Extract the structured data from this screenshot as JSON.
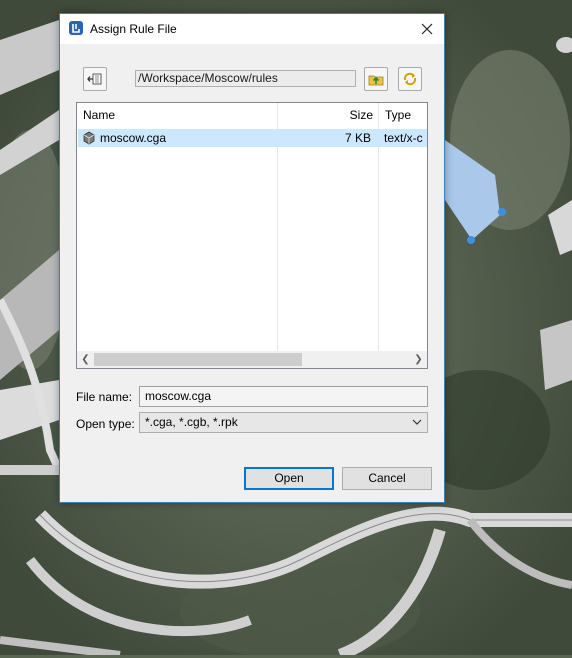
{
  "dialog": {
    "title": "Assign Rule File",
    "close_icon": "close-icon",
    "path": "/Workspace/Moscow/rules",
    "columns": [
      "Name",
      "Size",
      "Type"
    ],
    "files": [
      {
        "name": "moscow.cga",
        "size": "7 KB",
        "type": "text/x-c",
        "icon": "cga-file-icon"
      }
    ],
    "file_name_label": "File name:",
    "file_name_value": "moscow.cga",
    "open_type_label": "Open type:",
    "open_type_value": "*.cga, *.cgb, *.rpk",
    "open_label": "Open",
    "cancel_label": "Cancel"
  },
  "colors": {
    "accent": "#0078d7",
    "selection": "#cce8ff",
    "dialog_border": "#3c7fb1"
  }
}
